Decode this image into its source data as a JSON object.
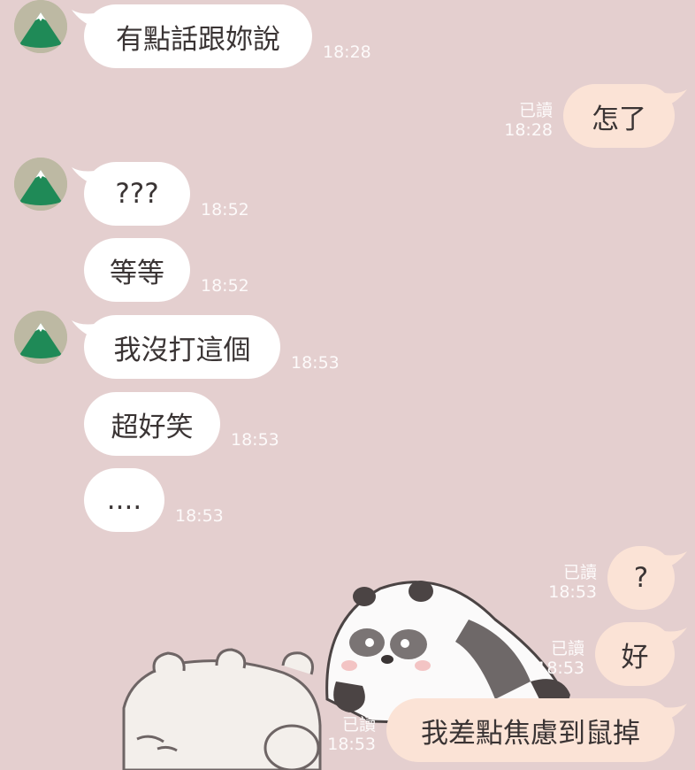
{
  "colors": {
    "background": "#e4cfcf",
    "incoming_bubble": "#ffffff",
    "outgoing_bubble": "#fbe3d6",
    "meta_text": "#fdfafa"
  },
  "contact": {
    "avatar_icon": "mountain-avatar-icon"
  },
  "messages": [
    {
      "from": "them",
      "text": "有點話跟妳說",
      "time": "18:28"
    },
    {
      "from": "me",
      "text": "怎了",
      "read": "已讀",
      "time": "18:28"
    },
    {
      "from": "them",
      "text": "???",
      "time": "18:52"
    },
    {
      "from": "them",
      "text": "等等",
      "time": "18:52"
    },
    {
      "from": "them",
      "text": "我沒打這個",
      "time": "18:53"
    },
    {
      "from": "them",
      "text": "超好笑",
      "time": "18:53"
    },
    {
      "from": "them",
      "text": "....",
      "time": "18:53"
    },
    {
      "from": "me",
      "text": "?",
      "read": "已讀",
      "time": "18:53"
    },
    {
      "from": "me",
      "text": "好",
      "read": "已讀",
      "time": "18:53"
    },
    {
      "from": "me",
      "text": "我差點焦慮到鼠掉",
      "read": "已讀",
      "time": "18:53"
    }
  ]
}
